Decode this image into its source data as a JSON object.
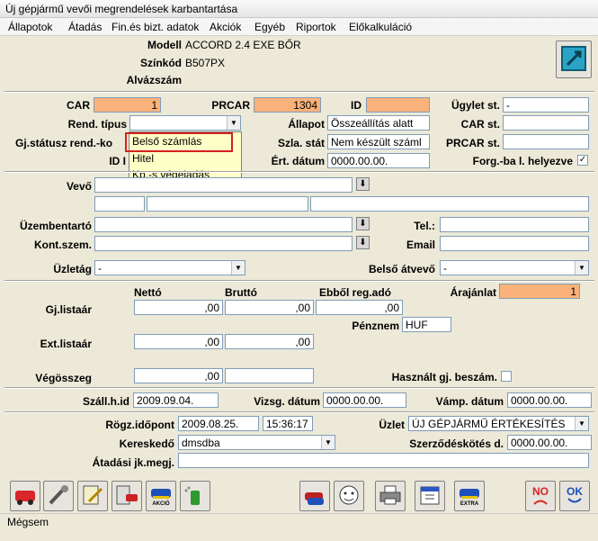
{
  "window": {
    "title": "Új gépjármű vevői megrendelések karbantartása"
  },
  "menu": [
    "Állapotok",
    "Átadás",
    "Fin.és bizt. adatok",
    "Akciók",
    "Egyéb",
    "Riportok",
    "Előkalkuláció"
  ],
  "header": {
    "modell_label": "Modell",
    "modell_value": "ACCORD 2.4 EXE BŐR",
    "szinkod_label": "Színkód",
    "szinkod_value": "B507PX",
    "alvazszam_label": "Alvázszám",
    "alvazszam_value": ""
  },
  "form": {
    "car_label": "CAR",
    "car_value": "1",
    "prcar_label": "PRCAR",
    "prcar_value": "1304",
    "id_label": "ID",
    "id_value": "",
    "ugylet_st_label": "Ügylet st.",
    "ugylet_st_value": "-",
    "rend_tipus_label": "Rend. típus",
    "rend_tipus_value": "",
    "allapot_label": "Állapot",
    "allapot_value": "Összeállítás alatt",
    "car_st_label": "CAR st.",
    "car_st_value": "",
    "gj_statusz_label": "Gj.státusz rend.-ko",
    "szla_stat_label": "Szla. stát",
    "szla_stat_value": "Nem készült száml",
    "prcar_st_label": "PRCAR st.",
    "prcar_st_value": "",
    "id2_label": "ID I",
    "ert_datum_label": "Ért. dátum",
    "ert_datum_value": "0000.00.00.",
    "forg_label": "Forg.-ba l. helyezve",
    "forg_checked": "✓",
    "vevo_label": "Vevő",
    "vevo_value": "",
    "uzembentarto_label": "Üzembentartó",
    "uzembentarto_value": "",
    "kont_szem_label": "Kont.szem.",
    "kont_szem_value": "",
    "tel_label": "Tel.:",
    "tel_value": "",
    "email_label": "Email",
    "email_value": "",
    "uzletag_label": "Üzletág",
    "uzletag_value": "-",
    "belso_atvevo_label": "Belső átvevő",
    "belso_atvevo_value": "-"
  },
  "dropdown": {
    "options": [
      "Belső számlás",
      "Hitel",
      "Kp.-s végeladás"
    ],
    "highlighted": "Belső számlás"
  },
  "prices": {
    "netto_label": "Nettó",
    "brutto_label": "Bruttó",
    "ebbol_label": "Ebből reg.adó",
    "arajanlat_label": "Árajánlat",
    "arajanlat_value": "1",
    "gj_listaar_label": "Gj.listaár",
    "gj_netto": ",00",
    "gj_brutto": ",00",
    "gj_regado": ",00",
    "penznem_label": "Pénznem",
    "penznem_value": "HUF",
    "ext_listaar_label": "Ext.listaár",
    "ext_netto": ",00",
    "ext_brutto": ",00",
    "vegosszeg_label": "Végösszeg",
    "vegosszeg_value": ",00",
    "vegosszeg_brutto": "",
    "hasznalt_label": "Használt gj. beszám."
  },
  "dates": {
    "szall_h_id_label": "Száll.h.id",
    "szall_h_id_value": "2009.09.04.",
    "vizsg_datum_label": "Vizsg. dátum",
    "vizsg_datum_value": "0000.00.00.",
    "vamp_datum_label": "Vámp. dátum",
    "vamp_datum_value": "0000.00.00."
  },
  "meta": {
    "rogz_label": "Rögz.időpont",
    "rogz_date": "2009.08.25.",
    "rogz_time": "15:36:17",
    "uzlet_label": "Üzlet",
    "uzlet_value": "ÚJ GÉPJÁRMŰ ÉRTÉKESÍTÉS",
    "kereskedo_label": "Kereskedő",
    "kereskedo_value": "dmsdba",
    "szerzodeskotes_label": "Szerződéskötés d.",
    "szerzodeskotes_value": "0000.00.00.",
    "atadasi_label": "Átadási jk.megj.",
    "atadasi_value": ""
  },
  "toolbar": {
    "akcio_label": "AKCIÓ",
    "extra_label": "EXTRA",
    "no_label": "NO",
    "ok_label": "OK"
  },
  "status": {
    "text": "Mégsem"
  }
}
